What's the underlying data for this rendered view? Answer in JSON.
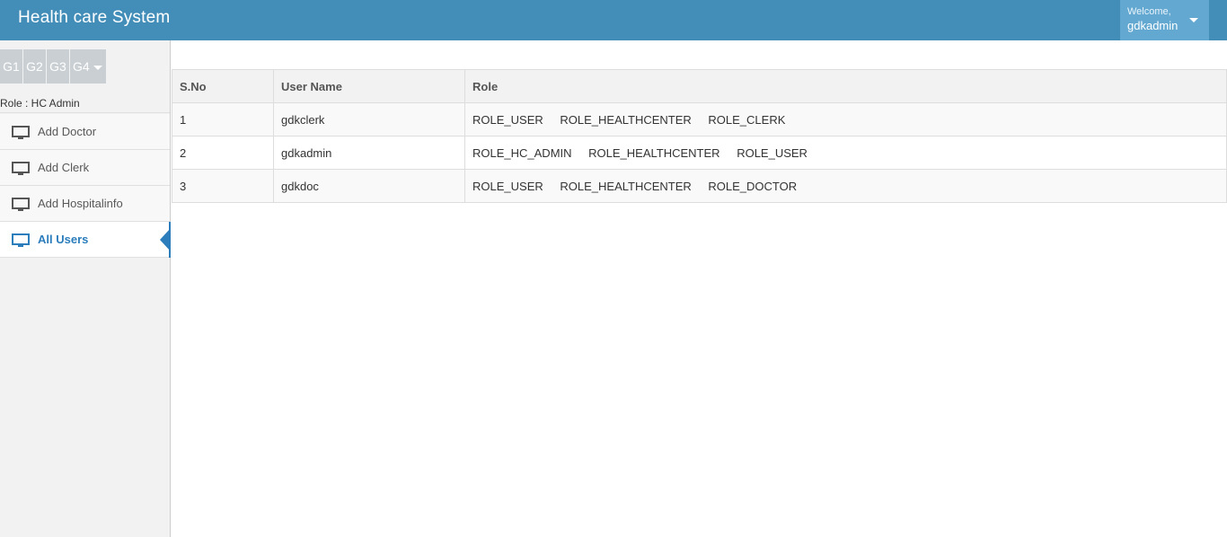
{
  "header": {
    "brand": "Health care System",
    "welcome_text": "Welcome,",
    "username": "gdkadmin"
  },
  "sidebar": {
    "shortcuts": [
      "G1",
      "G2",
      "G3",
      "G4"
    ],
    "role_label": "Role : HC Admin",
    "items": [
      {
        "label": "Add Doctor",
        "icon": "monitor-icon"
      },
      {
        "label": "Add Clerk",
        "icon": "monitor-icon"
      },
      {
        "label": "Add Hospitalinfo",
        "icon": "monitor-icon"
      },
      {
        "label": "All Users",
        "icon": "monitor-icon",
        "active": true
      }
    ]
  },
  "table": {
    "headers": [
      "S.No",
      "User Name",
      "Role"
    ],
    "rows": [
      {
        "sno": "1",
        "username": "gdkclerk",
        "roles": [
          "ROLE_USER",
          "ROLE_HEALTHCENTER",
          "ROLE_CLERK"
        ]
      },
      {
        "sno": "2",
        "username": "gdkadmin",
        "roles": [
          "ROLE_HC_ADMIN",
          "ROLE_HEALTHCENTER",
          "ROLE_USER"
        ]
      },
      {
        "sno": "3",
        "username": "gdkdoc",
        "roles": [
          "ROLE_USER",
          "ROLE_HEALTHCENTER",
          "ROLE_DOCTOR"
        ]
      }
    ]
  },
  "colors": {
    "navbar": "#438eb9",
    "user_menu": "#62a8d1",
    "active_accent": "#2b7dbc"
  }
}
